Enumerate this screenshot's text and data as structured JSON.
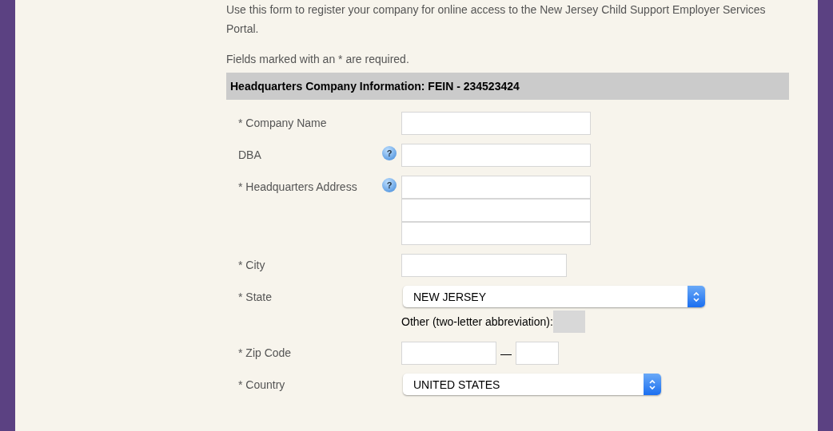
{
  "intro": "Use this form to register your company for online access to the New Jersey Child Support Employer Services Portal.",
  "required_note": "Fields marked with an * are required.",
  "section_title": "Headquarters Company Information: FEIN - 234523424",
  "fields": [
    {
      "kind": "text",
      "label": "* Company Name"
    },
    {
      "kind": "text",
      "label": "DBA",
      "help": "?"
    },
    {
      "kind": "address",
      "label": "* Headquarters Address",
      "help": "?"
    },
    {
      "kind": "short_text",
      "label": "* City"
    },
    {
      "kind": "select",
      "label": "* State",
      "value": "NEW JERSEY",
      "other_label": "Other (two-letter abbreviation):"
    },
    {
      "kind": "zip",
      "label": "* Zip Code",
      "separator": "—"
    },
    {
      "kind": "select",
      "label": "* Country",
      "value": "UNITED STATES"
    }
  ]
}
